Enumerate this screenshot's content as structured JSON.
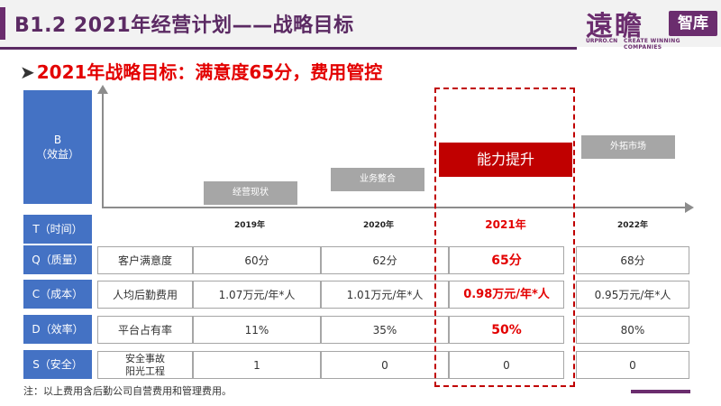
{
  "header": {
    "title": "B1.2  2021年经营计划——战略目标",
    "logo_main": "遠瞻",
    "logo_box": "智库",
    "logo_sub1": "URPRO.CN",
    "logo_sub2": "CREATE WINNING COMPANIES"
  },
  "subtitle": {
    "arrow": "➤",
    "text": "2021年战略目标：满意度65分，费用管控"
  },
  "chart": {
    "b_label_line1": "B",
    "b_label_line2": "（效益）",
    "steps": [
      "经营现状",
      "业务整合",
      "能力提升",
      "外拓市场"
    ]
  },
  "table": {
    "row_labels": [
      "T（时间）",
      "Q（质量）",
      "C（成本）",
      "D（效率）",
      "S（安全）"
    ],
    "years": [
      "2019年",
      "2020年",
      "2021年",
      "2022年"
    ],
    "metrics": [
      "客户满意度",
      "人均后勤费用",
      "平台占有率",
      "安全事故\n阳光工程"
    ],
    "rows": [
      [
        "60分",
        "62分",
        "65分",
        "68分"
      ],
      [
        "1.07万元/年*人",
        "1.01万元/年*人",
        "0.98万元/年*人",
        "0.95万元/年*人"
      ],
      [
        "11%",
        "35%",
        "50%",
        "80%"
      ],
      [
        "1",
        "0",
        "0",
        "0"
      ]
    ]
  },
  "note": "注：以上费用含后勤公司自营费用和管理费用。",
  "colors": {
    "brand": "#6b2d6e",
    "label_blue": "#4472c4",
    "highlight_red": "#e30000",
    "step_gray": "#a6a6a6"
  }
}
